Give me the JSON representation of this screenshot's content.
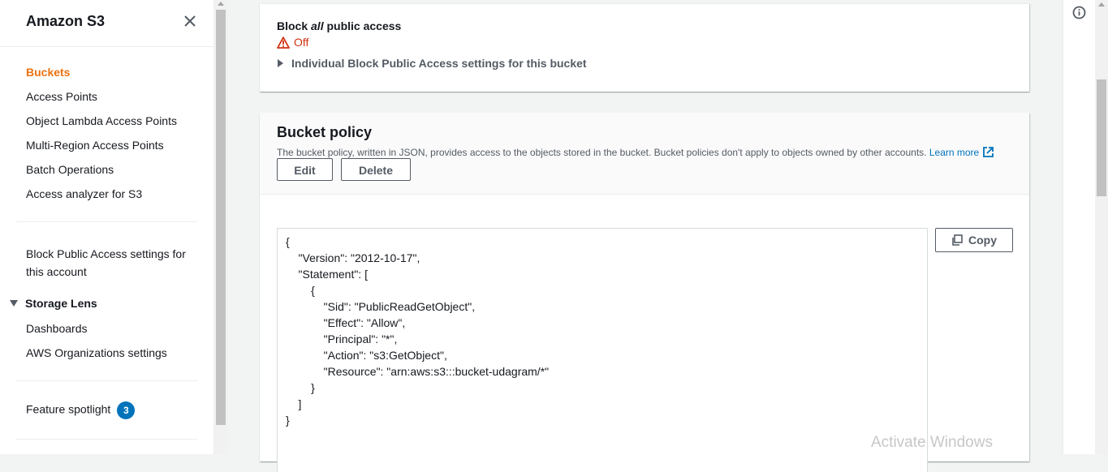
{
  "sidebar": {
    "title": "Amazon S3",
    "items": [
      {
        "label": "Buckets",
        "active": true
      },
      {
        "label": "Access Points"
      },
      {
        "label": "Object Lambda Access Points"
      },
      {
        "label": "Multi-Region Access Points"
      },
      {
        "label": "Batch Operations"
      },
      {
        "label": "Access analyzer for S3"
      }
    ],
    "block_public_access": "Block Public Access settings for this account",
    "storage_lens": {
      "label": "Storage Lens",
      "items": [
        {
          "label": "Dashboards"
        },
        {
          "label": "AWS Organizations settings"
        }
      ]
    },
    "feature_spotlight": {
      "label": "Feature spotlight",
      "badge": "3"
    }
  },
  "block_public_access": {
    "title_prefix": "Block ",
    "title_emphasis": "all",
    "title_suffix": " public access",
    "status": "Off",
    "expander": "Individual Block Public Access settings for this bucket"
  },
  "bucket_policy": {
    "title": "Bucket policy",
    "description": "The bucket policy, written in JSON, provides access to the objects stored in the bucket. Bucket policies don't apply to objects owned by other accounts.",
    "learn_more": "Learn more",
    "edit_label": "Edit",
    "delete_label": "Delete",
    "copy_label": "Copy",
    "code_lines": [
      "{",
      "    \"Version\": \"2012-10-17\",",
      "    \"Statement\": [",
      "        {",
      "            \"Sid\": \"PublicReadGetObject\",",
      "            \"Effect\": \"Allow\",",
      "            \"Principal\": \"*\",",
      "            \"Action\": \"s3:GetObject\",",
      "            \"Resource\": \"arn:aws:s3:::bucket-udagram/*\"",
      "        }",
      "    ]",
      "}"
    ]
  },
  "watermark": "Activate Windows",
  "colors": {
    "accent": "#ec7211",
    "link": "#0073bb",
    "error": "#d13212"
  }
}
